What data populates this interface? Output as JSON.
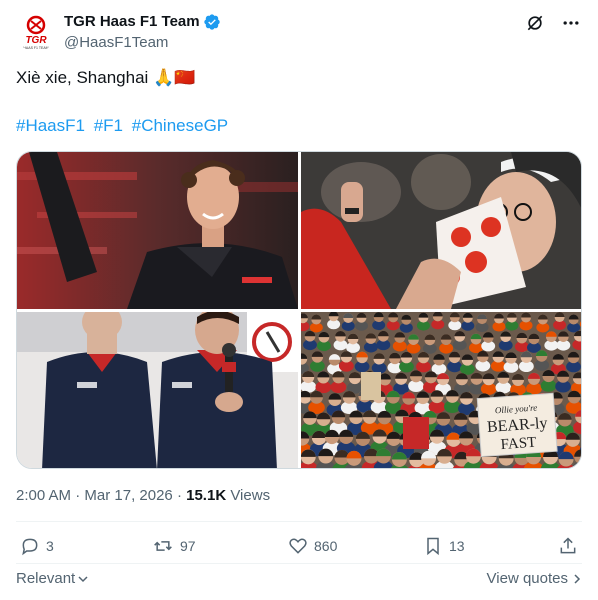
{
  "author": {
    "display_name": "TGR Haas F1 Team",
    "handle": "@HaasF1Team",
    "verified": true,
    "logo_text": "TGR",
    "logo_subtext": "HAAS F1 TEAM"
  },
  "tweet": {
    "text": "Xiè xie, Shanghai 🙏🇨🇳",
    "hashtags": [
      "#HaasF1",
      "#F1",
      "#ChineseGP"
    ],
    "media": [
      {
        "name": "driver-waving"
      },
      {
        "name": "fan-with-cap"
      },
      {
        "name": "drivers-on-stage"
      },
      {
        "name": "crowd",
        "sign_text": "Ollie you're BEAR-ly FAST"
      }
    ]
  },
  "meta": {
    "time": "2:00 AM",
    "separator": "·",
    "date": "Mar 17, 2026",
    "views_count": "15.1K",
    "views_label": "Views"
  },
  "actions": {
    "replies": "3",
    "reposts": "97",
    "likes": "860",
    "bookmarks": "13"
  },
  "footer": {
    "sort_label": "Relevant",
    "view_quotes_label": "View quotes"
  },
  "colors": {
    "link": "#1d9bf0",
    "verified": "#1d9bf0",
    "muted": "#536471",
    "brand_red": "#d50000"
  }
}
